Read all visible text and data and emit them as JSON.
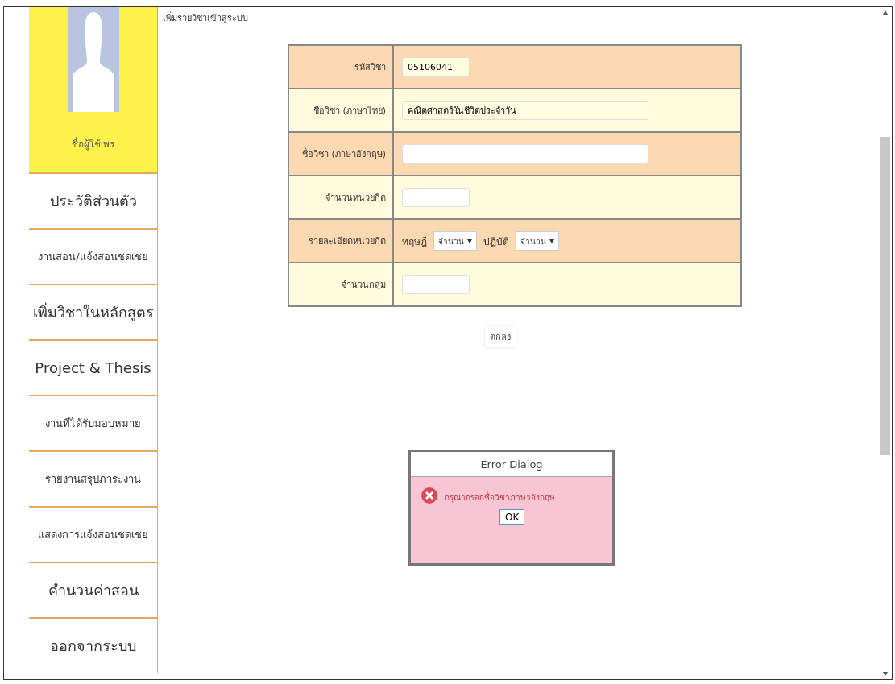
{
  "sidebar": {
    "user_name": "ชื่อผู้ใช้  พร",
    "items": [
      {
        "label": "ประวัติส่วนตัว",
        "kind": "large"
      },
      {
        "label": "งานสอน/แจ้งสอนชดเชย",
        "kind": "small"
      },
      {
        "label": "เพิ่มวิชาในหลักสูตร",
        "kind": "large"
      },
      {
        "label": "Project & Thesis",
        "kind": "large"
      },
      {
        "label": "งานที่ได้รับมอบหมาย",
        "kind": "small"
      },
      {
        "label": "รายงานสรุปภาระงาน",
        "kind": "small"
      },
      {
        "label": "แสดงการแจ้งสอนชดเชย",
        "kind": "small"
      },
      {
        "label": "คำนวนค่าสอน",
        "kind": "large"
      },
      {
        "label": "ออกจากระบบ",
        "kind": "large"
      }
    ]
  },
  "page_title": "เพิ่มรายวิชาเข้าสู่ระบบ",
  "form": {
    "rows": [
      {
        "label": "รหัสวิชา",
        "kind": "short",
        "value": "05106041"
      },
      {
        "label": "ชื่อวิชา (ภาษาไทย)",
        "kind": "long",
        "value": "คณิตศาสตร์ในชีวิตประจำวัน"
      },
      {
        "label": "ชื่อวิชา (ภาษาอังกฤษ)",
        "kind": "long"
      },
      {
        "label": "จำนวนหน่วยกิต",
        "kind": "short"
      },
      {
        "label": "รายละเอียดหน่วยกิต",
        "kind": "selects",
        "selects": [
          {
            "label": "ทฤษฎี",
            "value": "จำนวน"
          },
          {
            "label": "ปฏิบัติ",
            "value": "จำนวน"
          }
        ]
      },
      {
        "label": "จำนวนกลุ่ม",
        "kind": "short"
      }
    ],
    "submit": "ตกลง"
  },
  "dialog": {
    "title": "Error Dialog",
    "message": "กรุณากรอกชื่อวิชาภาษาอังกฤษ",
    "button": "OK"
  }
}
